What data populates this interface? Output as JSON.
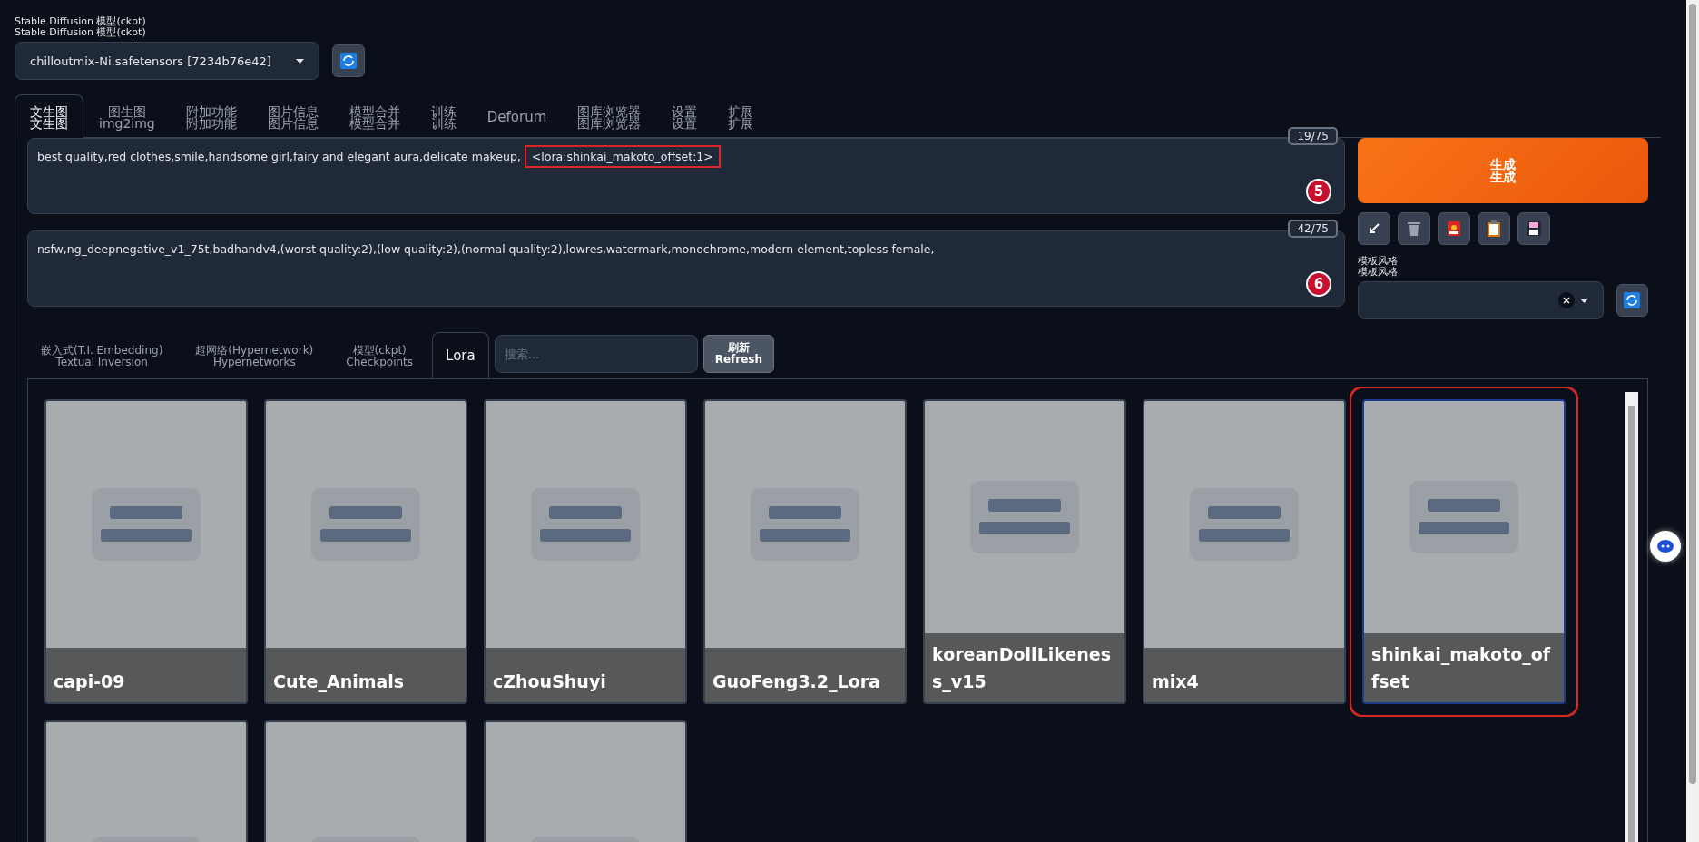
{
  "model": {
    "label_lines": [
      "Stable Diffusion 模型(ckpt)",
      "Stable Diffusion 模型(ckpt)"
    ],
    "value": "chilloutmix-Ni.safetensors [7234b76e42]"
  },
  "tabs": [
    {
      "lines": [
        "文生图",
        "文生图"
      ],
      "selected": true
    },
    {
      "lines": [
        "图生图",
        "img2img"
      ],
      "selected": false
    },
    {
      "lines": [
        "附加功能",
        "附加功能"
      ],
      "selected": false
    },
    {
      "lines": [
        "图片信息",
        "图片信息"
      ],
      "selected": false
    },
    {
      "lines": [
        "模型合并",
        "模型合并"
      ],
      "selected": false
    },
    {
      "lines": [
        "训练",
        "训练"
      ],
      "selected": false
    },
    {
      "lines": [
        "Deforum"
      ],
      "selected": false
    },
    {
      "lines": [
        "图库浏览器",
        "图库浏览器"
      ],
      "selected": false
    },
    {
      "lines": [
        "设置",
        "设置"
      ],
      "selected": false
    },
    {
      "lines": [
        "扩展",
        "扩展"
      ],
      "selected": false
    }
  ],
  "prompts": [
    {
      "text": "best quality,red clothes,smile,handsome girl,fairy and elegant aura,delicate makeup, ",
      "highlight": "<lora:shinkai_makoto_offset:1>",
      "token_count": "19/75",
      "marker": "5"
    },
    {
      "text": "nsfw,ng_deepnegative_v1_75t,badhandv4,(worst quality:2),(low quality:2),(normal quality:2),lowres,watermark,monochrome,modern element,topless female,",
      "token_count": "42/75",
      "marker": "6"
    }
  ],
  "generate_button": {
    "lines": [
      "生成",
      "生成"
    ]
  },
  "tool_buttons": [
    {
      "kind": "arrow"
    },
    {
      "kind": "trash"
    },
    {
      "kind": "card"
    },
    {
      "kind": "clipboard"
    },
    {
      "kind": "save"
    }
  ],
  "style": {
    "label_lines": [
      "模板风格",
      "模板风格"
    ]
  },
  "extra_tabs": [
    {
      "lines": [
        "嵌入式(T.I. Embedding)",
        "Textual Inversion"
      ],
      "selected": false
    },
    {
      "lines": [
        "超网络(Hypernetwork)",
        "Hypernetworks"
      ],
      "selected": false
    },
    {
      "lines": [
        "模型(ckpt)",
        "Checkpoints"
      ],
      "selected": false
    },
    {
      "lines": [
        "Lora"
      ],
      "selected": true
    }
  ],
  "search": {
    "placeholder": "搜索..."
  },
  "refresh_button": {
    "lines": [
      "刷新",
      "Refresh"
    ]
  },
  "cards": [
    {
      "name": "capi-09",
      "highlighted": false
    },
    {
      "name": "Cute_Animals",
      "highlighted": false
    },
    {
      "name": "cZhouShuyi",
      "highlighted": false
    },
    {
      "name": "GuoFeng3.2_Lora",
      "highlighted": false
    },
    {
      "name": "koreanDollLikeness_v15",
      "highlighted": false
    },
    {
      "name": "mix4",
      "highlighted": false
    },
    {
      "name": "shinkai_makoto_offset",
      "highlighted": true
    },
    {
      "highlighted": false
    },
    {
      "highlighted": false
    },
    {
      "highlighted": false
    }
  ]
}
